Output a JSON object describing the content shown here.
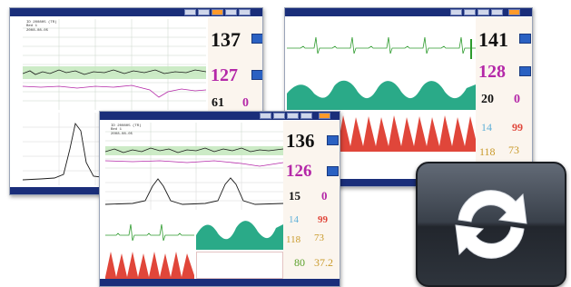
{
  "colors": {
    "bar": "#1a2e7a",
    "ecg": "#2e9b2e",
    "pleth": "#2aaa88",
    "resp": "#e0463a",
    "hr_text": "#111111",
    "spo2_text": "#b428a8",
    "accent_alarm": "#ff9a2a"
  },
  "monitor_left": {
    "hr_value": "137",
    "spo2_value": "127",
    "nibp_value": "61",
    "extra_value": "0",
    "patient_info": [
      "ID 200805 (TR)",
      "Bed 1",
      "2008-08-05"
    ]
  },
  "monitor_right": {
    "hr_value": "141",
    "spo2_value": "128",
    "nibp_value": "20",
    "extra_value": "0",
    "temp_value": "14",
    "resp_value": "99",
    "bp_value": "118",
    "bp_value2": "73"
  },
  "monitor_front": {
    "hr_value": "136",
    "spo2_value": "126",
    "nibp_value": "15",
    "extra_value": "0",
    "temp_value": "14",
    "resp_value": "99",
    "bp_value": "118",
    "bp_value2": "73",
    "pr_value": "80",
    "temp2_value": "37.2",
    "patient_info": [
      "ID 200805 (TR)",
      "Bed 1",
      "2008-08-05"
    ]
  },
  "refresh_button": {
    "icon": "refresh-icon"
  }
}
